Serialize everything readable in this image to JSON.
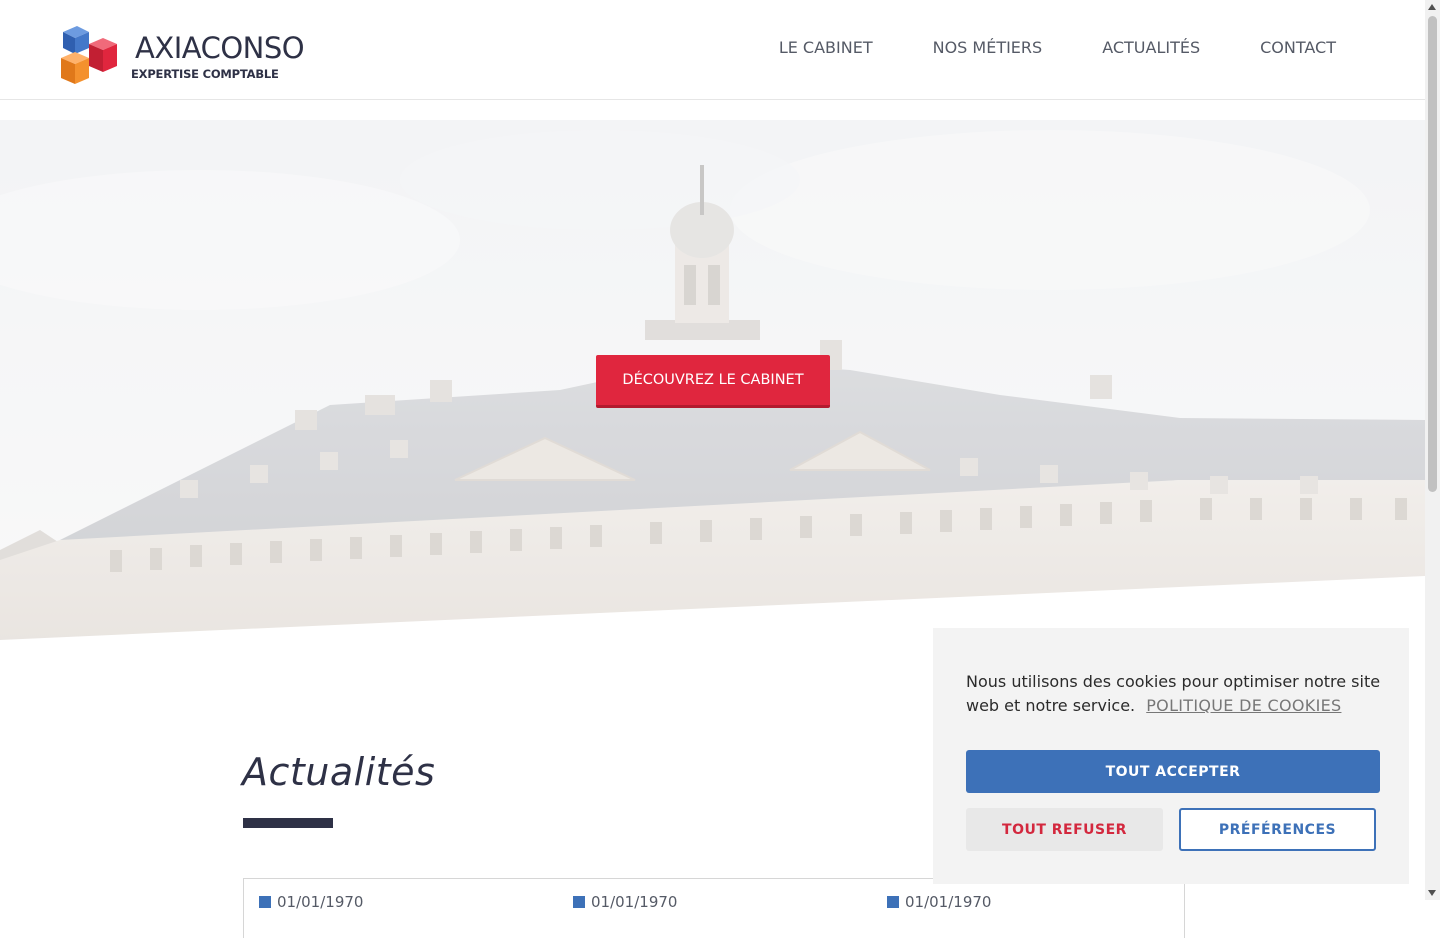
{
  "header": {
    "logo_name": "AXIACONSO",
    "logo_tagline": "EXPERTISE COMPTABLE",
    "nav": [
      "LE CABINET",
      "NOS MÉTIERS",
      "ACTUALITÉS",
      "CONTACT"
    ]
  },
  "hero": {
    "cta_label": "DÉCOUVREZ LE CABINET"
  },
  "news": {
    "title": "Actualités",
    "dates": [
      "01/01/1970",
      "01/01/1970",
      "01/01/1970"
    ]
  },
  "cookie": {
    "text": "Nous utilisons des cookies pour optimiser notre site web et notre service.",
    "policy_link": "POLITIQUE DE COOKIES",
    "accept": "TOUT ACCEPTER",
    "refuse": "TOUT REFUSER",
    "preferences": "PRÉFÉRENCES"
  },
  "colors": {
    "brand_red": "#e0263e",
    "brand_blue": "#3d71b8",
    "brand_navy": "#2e3146"
  }
}
